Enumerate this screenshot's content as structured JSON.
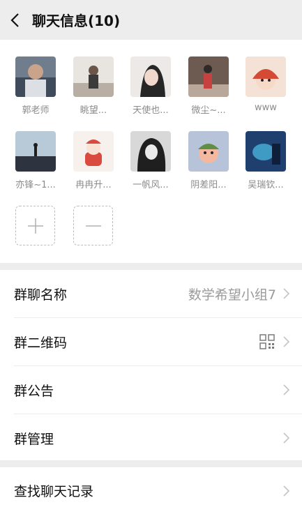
{
  "header": {
    "title": "聊天信息(10)"
  },
  "members": [
    {
      "name": "郭老师",
      "colors": [
        "#3f4b5a",
        "#c9b5a3"
      ]
    },
    {
      "name": "眺望...",
      "colors": [
        "#d9d4d0",
        "#8d7e6f"
      ]
    },
    {
      "name": "天使也...",
      "colors": [
        "#e6e3df",
        "#2a2a2a"
      ]
    },
    {
      "name": "微尘~...",
      "colors": [
        "#4a3f3b",
        "#c84141"
      ]
    },
    {
      "name": "www",
      "colors": [
        "#f5e2d6",
        "#d54a35"
      ]
    },
    {
      "name": "亦锋~1...",
      "colors": [
        "#9fb6c9",
        "#2d3440"
      ]
    },
    {
      "name": "冉冉升...",
      "colors": [
        "#f6f1ec",
        "#d94b3f"
      ]
    },
    {
      "name": "一帆风...",
      "colors": [
        "#2b2b2b",
        "#e0e0e0"
      ]
    },
    {
      "name": "阴差阳...",
      "colors": [
        "#b7c3d8",
        "#5e8f45"
      ]
    },
    {
      "name": "吴瑞钦...",
      "colors": [
        "#1f3f6f",
        "#4dc3e8"
      ]
    }
  ],
  "settings": [
    {
      "label": "群聊名称",
      "value": "数学希望小组7"
    },
    {
      "label": "群二维码",
      "value": ""
    },
    {
      "label": "群公告",
      "value": ""
    },
    {
      "label": "群管理",
      "value": ""
    }
  ],
  "search": {
    "label": "查找聊天记录"
  }
}
